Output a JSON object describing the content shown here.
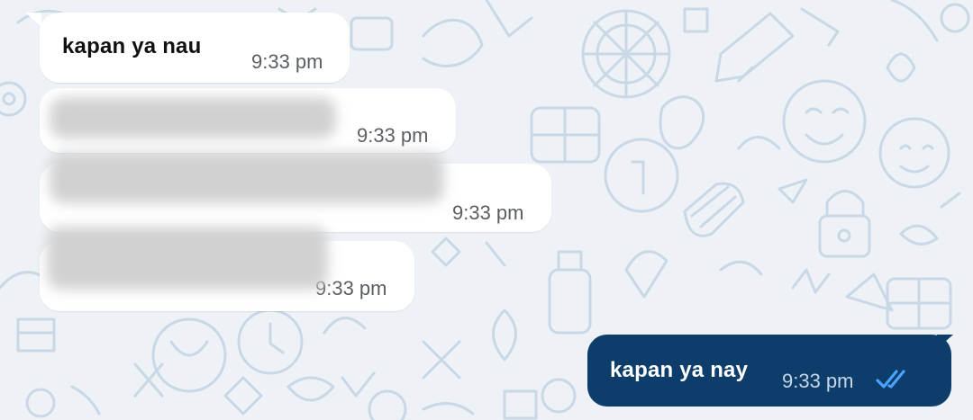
{
  "messages": [
    {
      "type": "incoming",
      "text": "kapan ya nau",
      "time": "9:33 pm"
    },
    {
      "type": "incoming",
      "text": "",
      "time": "9:33 pm"
    },
    {
      "type": "incoming",
      "text": "",
      "time": "9:33 pm"
    },
    {
      "type": "incoming",
      "text": "",
      "time": "9:33 pm"
    },
    {
      "type": "outgoing",
      "text": "kapan ya nay",
      "time": "9:33 pm",
      "status_icon": "double-check-icon"
    }
  ],
  "colors": {
    "chat_background": "#eef2f6",
    "incoming_bubble": "#ffffff",
    "outgoing_bubble": "#0d3d6b",
    "read_receipt": "#4aa3ff"
  }
}
